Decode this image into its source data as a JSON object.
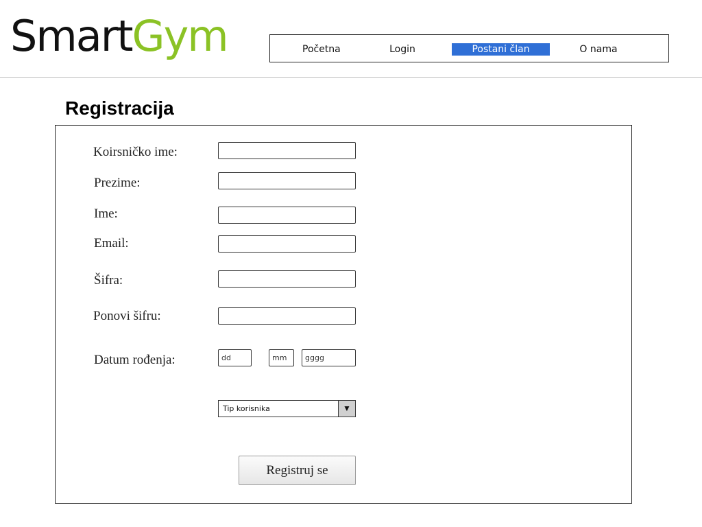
{
  "logo": {
    "part1": "Smart",
    "part2": "Gym",
    "color_part1": "#111111",
    "color_part2": "#8bc225"
  },
  "nav": {
    "items": [
      {
        "label": "Početna",
        "active": false
      },
      {
        "label": "Login",
        "active": false
      },
      {
        "label": "Postani član",
        "active": true
      },
      {
        "label": "O nama",
        "active": false
      }
    ],
    "active_color": "#2f6fd6"
  },
  "page": {
    "title": "Registracija"
  },
  "form": {
    "fields": {
      "username": {
        "label": "Koirsničko ime:",
        "value": ""
      },
      "lastname": {
        "label": "Prezime:",
        "value": ""
      },
      "firstname": {
        "label": "Ime:",
        "value": ""
      },
      "email": {
        "label": "Email:",
        "value": ""
      },
      "password": {
        "label": "Šifra:",
        "value": ""
      },
      "password_repeat": {
        "label": "Ponovi šifru:",
        "value": ""
      }
    },
    "birthdate": {
      "label": "Datum rođenja:",
      "day_placeholder": "dd",
      "month_placeholder": "mm",
      "year_placeholder": "gggg"
    },
    "user_type": {
      "selected": "Tip korisnika",
      "arrow_icon": "triangle-down-icon"
    },
    "submit_label": "Registruj se"
  }
}
